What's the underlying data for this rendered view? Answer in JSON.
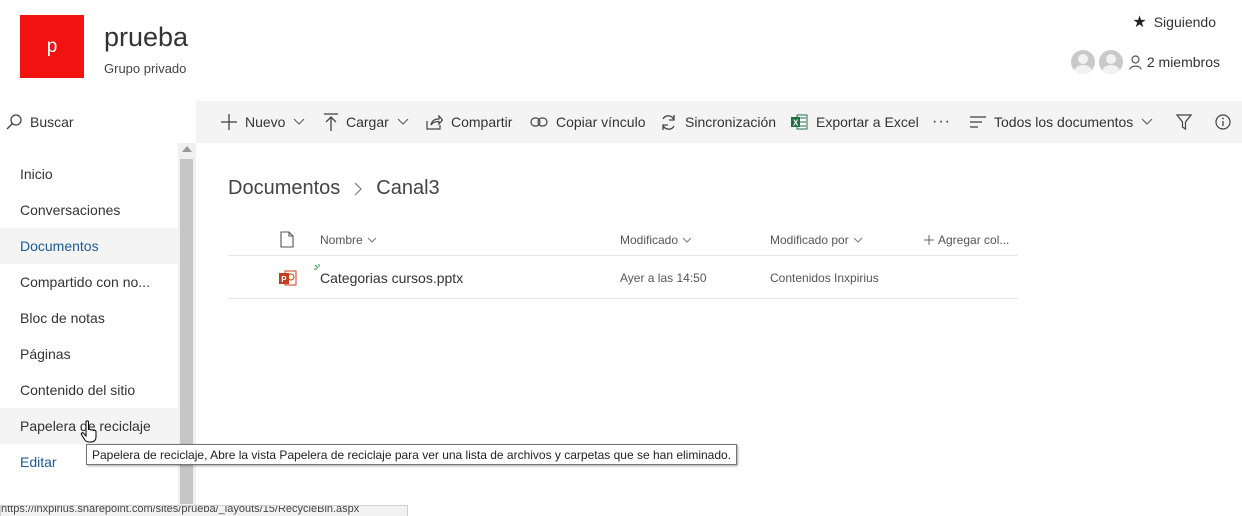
{
  "header": {
    "logo_letter": "p",
    "logo_color": "#f0130f",
    "site_title": "prueba",
    "site_subtitle": "Grupo privado",
    "follow_label": "Siguiendo",
    "members_label": "2 miembros"
  },
  "search": {
    "placeholder": "Buscar"
  },
  "commands": {
    "new": "Nuevo",
    "upload": "Cargar",
    "share": "Compartir",
    "copy_link": "Copiar vínculo",
    "sync": "Sincronización",
    "export": "Exportar a Excel",
    "more": "···",
    "view": "Todos los documentos"
  },
  "nav": {
    "items": [
      {
        "label": "Inicio"
      },
      {
        "label": "Conversaciones"
      },
      {
        "label": "Documentos"
      },
      {
        "label": "Compartido con no..."
      },
      {
        "label": "Bloc de notas"
      },
      {
        "label": "Páginas"
      },
      {
        "label": "Contenido del sitio"
      },
      {
        "label": "Papelera de reciclaje"
      }
    ],
    "edit_label": "Editar"
  },
  "breadcrumb": {
    "root": "Documentos",
    "current": "Canal3"
  },
  "list": {
    "columns": {
      "name": "Nombre",
      "modified": "Modificado",
      "modified_by": "Modificado por",
      "add_column": "Agregar col..."
    },
    "rows": [
      {
        "name": "Categorias cursos.pptx",
        "modified": "Ayer a las 14:50",
        "modified_by": "Contenidos Inxpirius"
      }
    ]
  },
  "tooltip": "Papelera de reciclaje, Abre la vista Papelera de reciclaje para ver una lista de archivos y carpetas que se han eliminado.",
  "status_url": "https://inxpirius.sharepoint.com/sites/prueba/_layouts/15/RecycleBin.aspx",
  "colors": {
    "accent": "#1a5a96",
    "ppt": "#c43e1c"
  }
}
